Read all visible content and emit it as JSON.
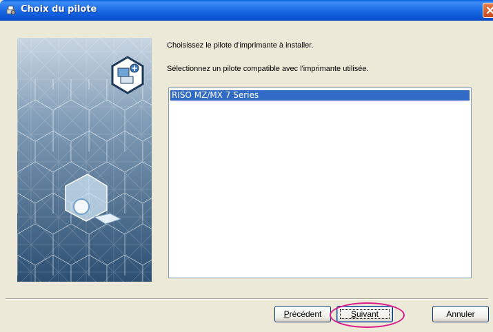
{
  "window": {
    "title": "Choix du pilote"
  },
  "instructions": {
    "line1": "Choisissez le pilote d'imprimante à installer.",
    "line2": "Sélectionnez un pilote compatible avec l'imprimante utilisée."
  },
  "driver_list": {
    "items": [
      {
        "label": "RISO MZ/MX 7 Series",
        "selected": true
      }
    ]
  },
  "buttons": {
    "back": {
      "first_char": "P",
      "rest": "récédent"
    },
    "next": {
      "first_char": "S",
      "rest": "uivant"
    },
    "cancel": "Annuler"
  },
  "colors": {
    "selection": "#316ac5",
    "highlight_ring": "#e0188a",
    "titlebar": "#0c58d6"
  },
  "icons": {
    "title": "printer-setup-icon",
    "close": "close-icon",
    "badge": "network-printer-add-icon"
  }
}
